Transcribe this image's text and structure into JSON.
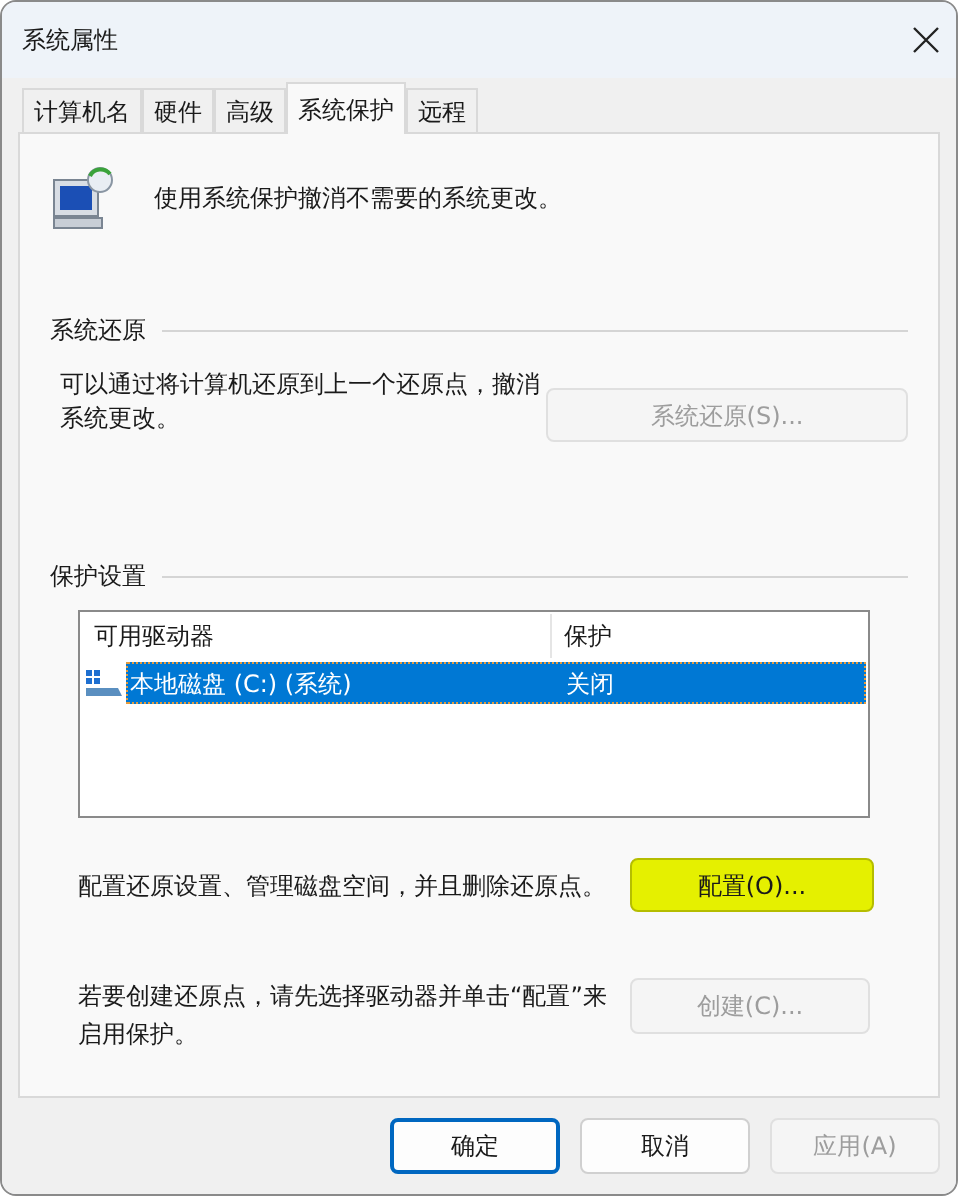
{
  "window": {
    "title": "系统属性"
  },
  "tabs": [
    {
      "label": "计算机名",
      "selected": false
    },
    {
      "label": "硬件",
      "selected": false
    },
    {
      "label": "高级",
      "selected": false
    },
    {
      "label": "系统保护",
      "selected": true
    },
    {
      "label": "远程",
      "selected": false
    }
  ],
  "intro": "使用系统保护撤消不需要的系统更改。",
  "restore": {
    "heading": "系统还原",
    "text": "可以通过将计算机还原到上一个还原点，撤消系统更改。",
    "button": {
      "label": "系统还原(S)...",
      "disabled": true,
      "highlighted": false
    }
  },
  "protection": {
    "heading": "保护设置",
    "table": {
      "columns": [
        "可用驱动器",
        "保护"
      ],
      "rows": [
        {
          "cells": [
            "本地磁盘 (C:) (系统)",
            "关闭"
          ],
          "selected": true
        }
      ]
    },
    "configure": {
      "text": "配置还原设置、管理磁盘空间，并且删除还原点。",
      "button": {
        "label": "配置(O)...",
        "disabled": false,
        "highlighted": true
      }
    },
    "create": {
      "text": "若要创建还原点，请先选择驱动器并单击“配置”来启用保护。",
      "button": {
        "label": "创建(C)...",
        "disabled": true,
        "highlighted": false
      }
    }
  },
  "buttons": [
    {
      "label": "确定",
      "default": true,
      "disabled": false
    },
    {
      "label": "取消",
      "default": false,
      "disabled": false
    },
    {
      "label": "应用(A)",
      "default": false,
      "disabled": true
    }
  ]
}
